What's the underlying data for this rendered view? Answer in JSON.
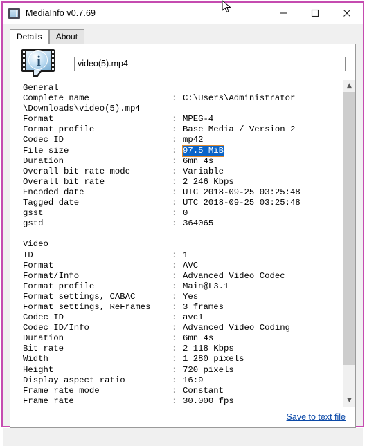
{
  "window": {
    "title": "MediaInfo v0.7.69",
    "icon": "mediainfo-app-icon",
    "accent_border_color": "#c54bb0",
    "controls": {
      "minimize": "minimize-icon",
      "maximize": "maximize-icon",
      "close": "close-icon"
    }
  },
  "tabs": [
    {
      "label": "Details",
      "active": true
    },
    {
      "label": "About",
      "active": false
    }
  ],
  "filename_field": {
    "value": "video(5).mp4",
    "placeholder": ""
  },
  "logo": {
    "letter": "i",
    "name": "mediainfo-logo"
  },
  "info": {
    "sections": [
      {
        "name": "General",
        "rows": [
          {
            "key": "Complete name",
            "value": "C:\\Users\\Administrator"
          },
          {
            "key": "\\Downloads\\video(5).mp4",
            "value": "",
            "no_sep": true
          },
          {
            "key": "Format",
            "value": "MPEG-4"
          },
          {
            "key": "Format profile",
            "value": "Base Media / Version 2"
          },
          {
            "key": "Codec ID",
            "value": "mp42"
          },
          {
            "key": "File size",
            "value": "97.5 MiB",
            "selected": true
          },
          {
            "key": "Duration",
            "value": "6mn 4s"
          },
          {
            "key": "Overall bit rate mode",
            "value": "Variable"
          },
          {
            "key": "Overall bit rate",
            "value": "2 246 Kbps"
          },
          {
            "key": "Encoded date",
            "value": "UTC 2018-09-25 03:25:48"
          },
          {
            "key": "Tagged date",
            "value": "UTC 2018-09-25 03:25:48"
          },
          {
            "key": "gsst",
            "value": "0"
          },
          {
            "key": "gstd",
            "value": "364065"
          }
        ]
      },
      {
        "name": "Video",
        "rows": [
          {
            "key": "ID",
            "value": "1"
          },
          {
            "key": "Format",
            "value": "AVC"
          },
          {
            "key": "Format/Info",
            "value": "Advanced Video Codec"
          },
          {
            "key": "Format profile",
            "value": "Main@L3.1"
          },
          {
            "key": "Format settings, CABAC",
            "value": "Yes"
          },
          {
            "key": "Format settings, ReFrames",
            "value": "3 frames"
          },
          {
            "key": "Codec ID",
            "value": "avc1"
          },
          {
            "key": "Codec ID/Info",
            "value": "Advanced Video Coding"
          },
          {
            "key": "Duration",
            "value": "6mn 4s"
          },
          {
            "key": "Bit rate",
            "value": "2 118 Kbps"
          },
          {
            "key": "Width",
            "value": "1 280 pixels"
          },
          {
            "key": "Height",
            "value": "720 pixels"
          },
          {
            "key": "Display aspect ratio",
            "value": "16:9"
          },
          {
            "key": "Frame rate mode",
            "value": "Constant"
          },
          {
            "key": "Frame rate",
            "value": "30.000 fps"
          }
        ]
      }
    ],
    "selection_color": "#0a64c8",
    "separator": ":"
  },
  "footer": {
    "save_link": "Save to text file"
  },
  "scrollbar": {
    "up_arrow": "chevron-up-icon",
    "down_arrow": "chevron-down-icon"
  }
}
